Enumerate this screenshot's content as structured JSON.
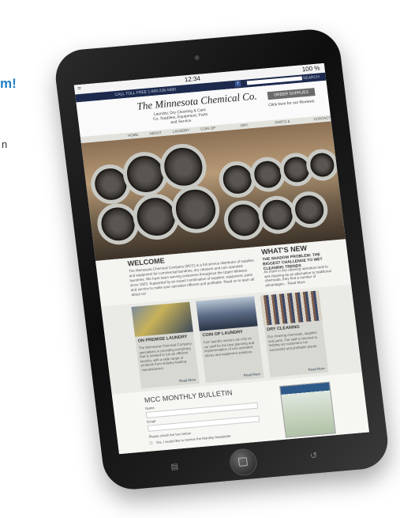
{
  "background": {
    "headline_fragment": "m!",
    "body_fragment": "n"
  },
  "status_bar": {
    "time": "12:34",
    "battery": "100 %"
  },
  "site": {
    "phone": "CALL TOLL FREE 1-800-238-5680",
    "search_label": "SEARCH",
    "logo": "The Minnesota Chemical Co.",
    "tagline": "Laundry, Dry Cleaning & Care Co. Supplies, Equipment, Parts and Service",
    "order_button": "ORDER SUPPLIES",
    "review_link": "Click here for our Reviews",
    "nav": [
      "HOME",
      "ABOUT",
      "LAUNDRY",
      "COIN OP LAUNDRY",
      "DRY CLEANING",
      "PARTS & SERVICE",
      "CONTACT"
    ]
  },
  "welcome": {
    "title": "WELCOME",
    "body": "The Minnesota Chemical Company (MCC) is a full service distributor of supplies and equipment for commercial laundries, dry cleaners and coin operated laundries. We have been serving customers throughout the Upper Midwest since 1923. Supported by an expert combination of supplies, equipment, parts and service to make your operation efficient and profitable. Read on to learn all about us!"
  },
  "news": {
    "title": "WHAT'S NEW",
    "headline": "THE SHADOW PROBLEM: THE BIGGEST CHALLENGE TO WET CLEANING TRENDS",
    "body": "As more in dry cleaning operators look to wet cleaning as an alternative to traditional chemicals, they find a number of advantages... Read More"
  },
  "cards": [
    {
      "title": "ON PREMISE LAUNDRY",
      "desc": "The Minnesota Chemical Company specializes in providing everything that is needed to run an efficient laundry, with a wide range of products from industry-leading manufacturers.",
      "more": "Read More"
    },
    {
      "title": "COIN OP LAUNDRY",
      "desc": "Coin laundry owners can rely on our staff for the best planning and implementation of coin operated stores and equipment solutions.",
      "more": "Read More"
    },
    {
      "title": "DRY CLEANING",
      "desc": "Dry cleaning chemicals, supplies and parts. Our staff is devoted to helping our customers run successful and profitable plants.",
      "more": "Read More"
    }
  ],
  "bulletin": {
    "title": "MCC MONTHLY BULLETIN",
    "name_label": "Name",
    "email_label": "Email",
    "check_label": "Please check the box below",
    "opt_label": "Yes, I would like to receive the Monthly Newsletter"
  },
  "colors": {
    "headline_blue": "#1f7fc6",
    "site_topbar": "#1d2a4d"
  }
}
